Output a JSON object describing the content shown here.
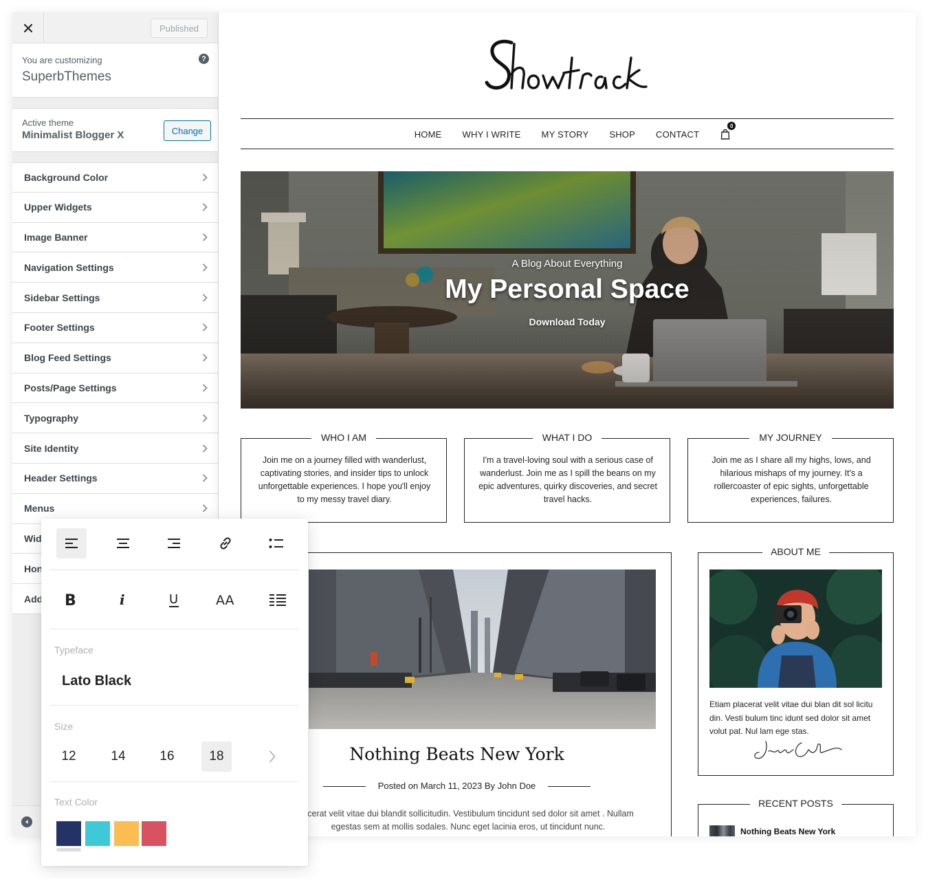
{
  "customizer": {
    "published_label": "Published",
    "customizing_label": "You are customizing",
    "site_name": "SuperbThemes",
    "active_theme_label": "Active theme",
    "active_theme_name": "Minimalist Blogger X",
    "change_label": "Change",
    "menu": [
      "Background Color",
      "Upper Widgets",
      "Image Banner",
      "Navigation Settings",
      "Sidebar Settings",
      "Footer Settings",
      "Blog Feed Settings",
      "Posts/Page Settings",
      "Typography",
      "Site Identity",
      "Header Settings",
      "Menus",
      "Wid",
      "Hon",
      "Add"
    ]
  },
  "site": {
    "logo_text": "Showtrack",
    "nav": [
      "HOME",
      "WHY I WRITE",
      "MY STORY",
      "SHOP",
      "CONTACT"
    ],
    "cart_count": "0",
    "hero": {
      "subtitle": "A Blog About Everything",
      "title": "My Personal Space",
      "cta": "Download Today"
    },
    "boxes": [
      {
        "title": "WHO I AM",
        "body": "Join me on a journey filled with wanderlust, captivating stories, and insider tips to unlock unforgettable experiences. I hope you'll enjoy to my messy travel diary."
      },
      {
        "title": "WHAT I DO",
        "body": "I'm a travel-loving soul with a serious case of wanderlust. Join me as I spill the beans on my epic adventures, quirky discoveries, and secret travel hacks."
      },
      {
        "title": "MY JOURNEY",
        "body": "Join me as I share all my highs, lows, and hilarious mishaps of my journey. It's a rollercoaster of epic sights, unforgettable experiences, failures."
      }
    ],
    "post": {
      "title": "Nothing Beats New York",
      "posted_on_label": "Posted on",
      "date": "March 11, 2023",
      "author": "By John Doe",
      "excerpt": "acerat velit vitae dui blandit sollicitudin. Vestibulum tincidunt sed dolor sit amet . Nullam egestas sem at mollis sodales. Nunc eget lacinia eros, ut tincidunt nunc."
    },
    "about": {
      "title": "ABOUT ME",
      "text": "Etiam placerat velit vitae dui blan dit sol licitu din. Vesti bulum tinc idunt sed dolor sit amet volut pat. Nul lam ege stas.",
      "signature": "Jenifer Carter"
    },
    "recent": {
      "title": "RECENT POSTS",
      "items": [
        "Nothing Beats New York"
      ]
    }
  },
  "panel": {
    "alignment_tools": [
      "align-left-icon",
      "align-center-icon",
      "align-right-icon",
      "link-icon",
      "list-icon"
    ],
    "format_tools": [
      "bold-icon",
      "italic-icon",
      "underline-icon",
      "text-size-icon",
      "justify-icon"
    ],
    "typeface_label": "Typeface",
    "typeface_value": "Lato Black",
    "size_label": "Size",
    "sizes": [
      "12",
      "14",
      "16",
      "18"
    ],
    "selected_size": "18",
    "text_color_label": "Text Color",
    "colors": [
      "#233366",
      "#3ec9d6",
      "#fbbd52",
      "#d8525f"
    ]
  }
}
